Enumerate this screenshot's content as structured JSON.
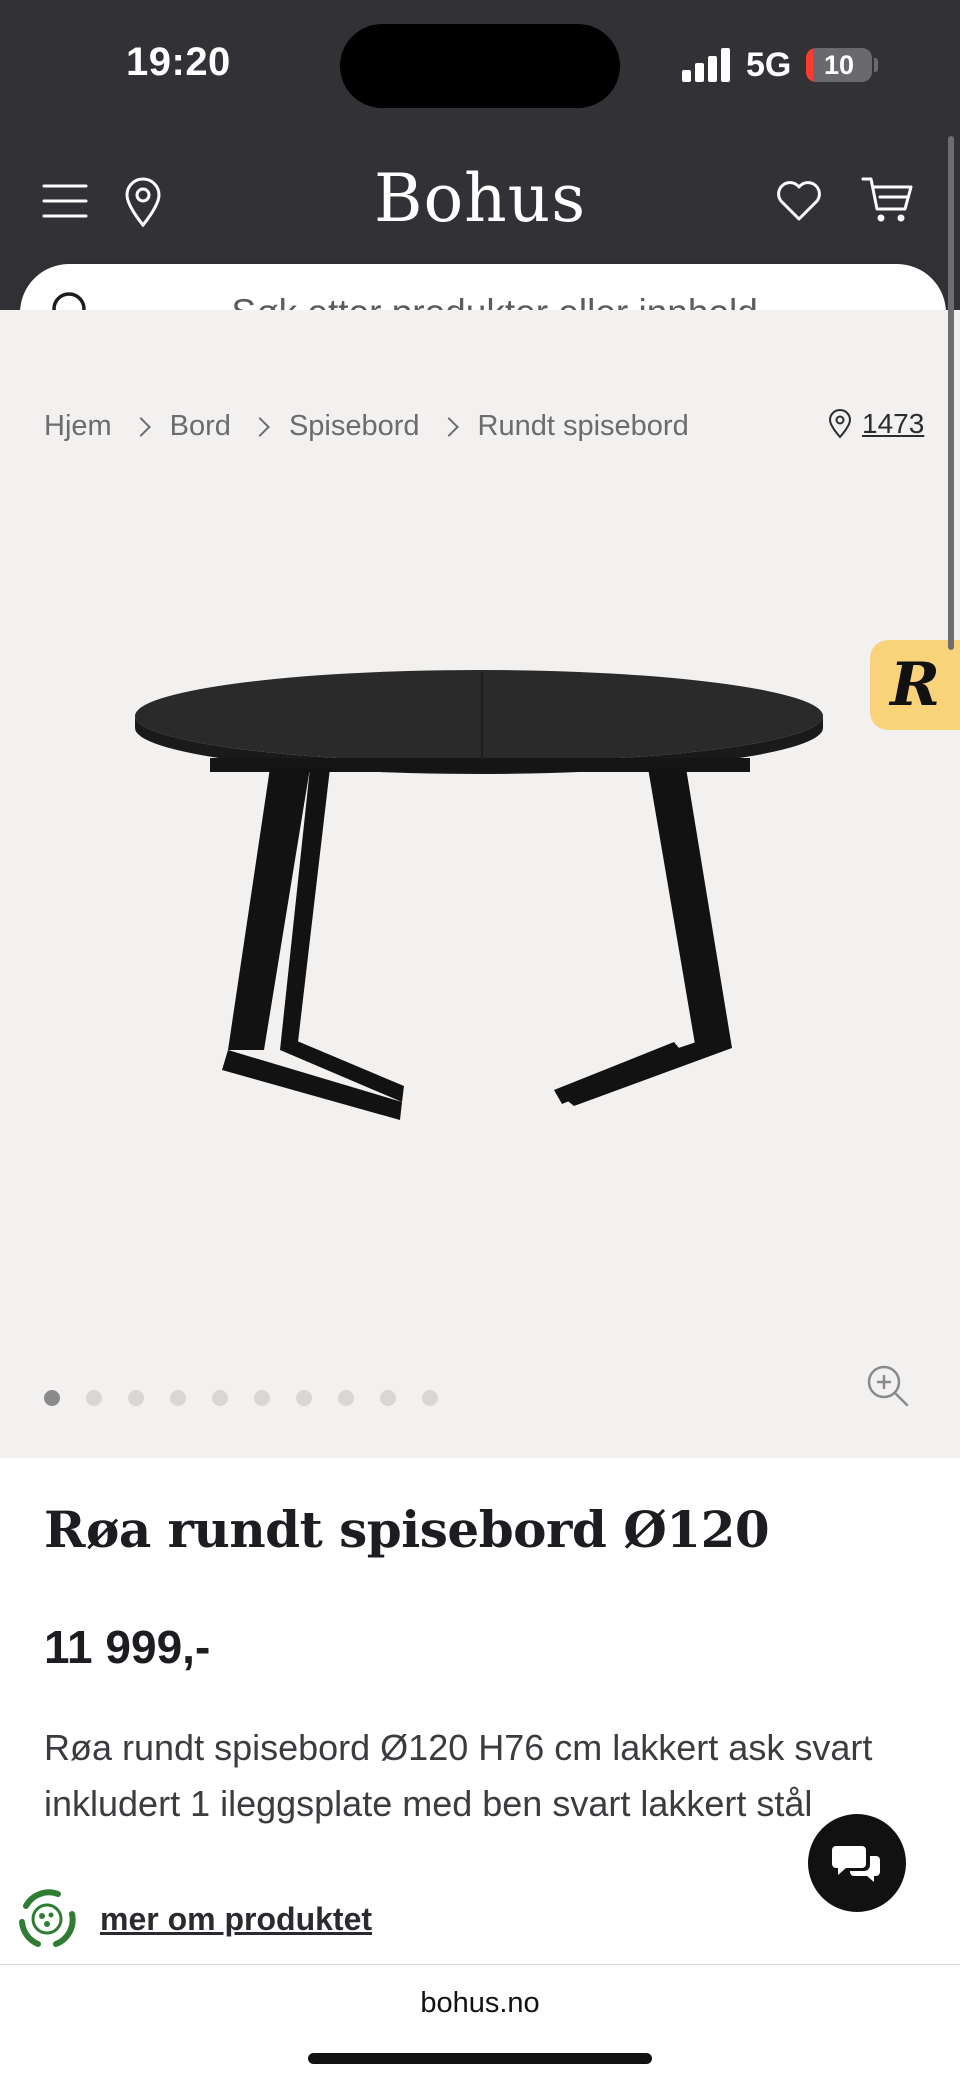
{
  "status_bar": {
    "time": "19:20",
    "network": "5G",
    "battery": "10",
    "battery_level": 0.1,
    "signal_bars": 4
  },
  "header": {
    "logo": "Bohus",
    "icons": [
      "menu-icon",
      "location-pin-icon",
      "heart-icon",
      "cart-icon"
    ]
  },
  "search": {
    "placeholder": "Søk etter produkter eller innhold..."
  },
  "breadcrumb": {
    "items": [
      "Hjem",
      "Bord",
      "Spisebord",
      "Rundt spisebord"
    ]
  },
  "store": {
    "label": "1473"
  },
  "gallery": {
    "image_count": 10,
    "active_index": 0,
    "badge_letter": "R"
  },
  "product": {
    "title": "Røa rundt spisebord Ø120",
    "price": "11 999,-",
    "description": "Røa rundt spisebord Ø120 H76 cm lakkert ask svart inkludert 1 ileggsplate med ben svart lakkert stål",
    "more_link": "mer om produktet"
  },
  "browser": {
    "url": "bohus.no"
  },
  "colors": {
    "header_bg": "#323236",
    "gallery_bg": "#f3f1ef",
    "badge_bg": "#f9d37a",
    "eco_green": "#2e7d32"
  }
}
